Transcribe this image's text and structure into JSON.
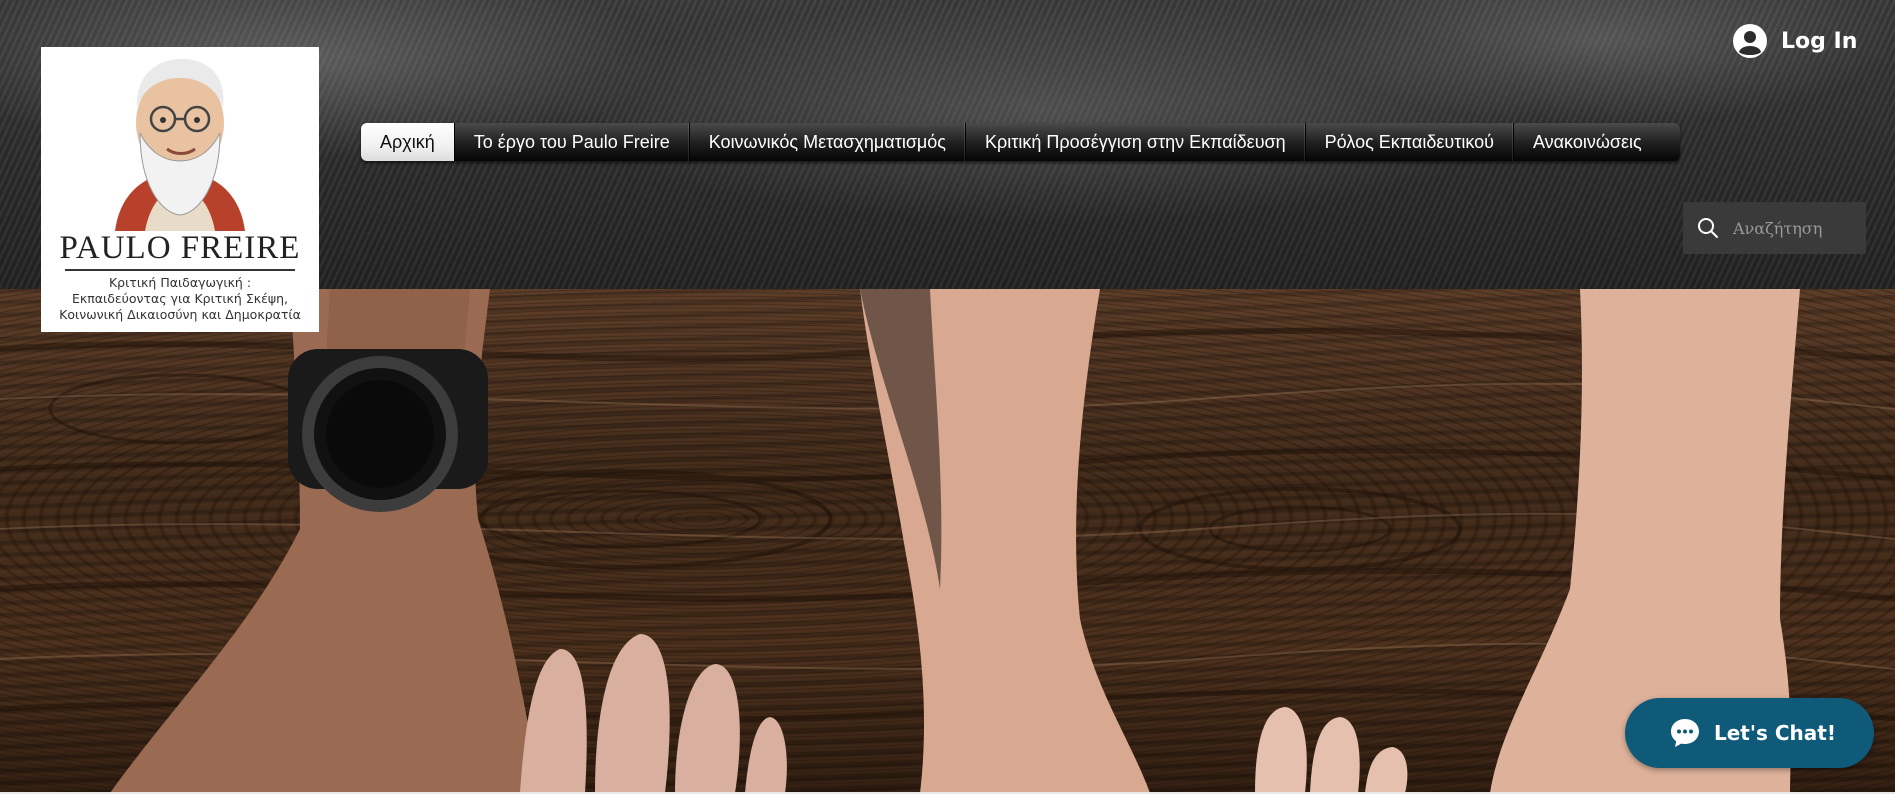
{
  "logo": {
    "title": "PAULO FREIRE",
    "subtitle_lines": [
      "Κριτική Παιδαγωγική :",
      "Εκπαιδεύοντας για Κριτική Σκέψη,",
      "Κοινωνική Δικαιοσύνη και Δημοκρατία"
    ]
  },
  "header": {
    "login_label": "Log In",
    "login_icon": "user-avatar-icon"
  },
  "nav": {
    "items": [
      {
        "label": "Αρχική",
        "active": true
      },
      {
        "label": "Το έργο του Paulo Freire",
        "active": false
      },
      {
        "label": "Κοινωνικός Μετασχηματισμός",
        "active": false
      },
      {
        "label": "Κριτική Προσέγγιση στην Εκπαίδευση",
        "active": false
      },
      {
        "label": "Ρόλος Εκπαιδευτικού",
        "active": false
      },
      {
        "label": "Ανακοινώσεις",
        "active": false
      }
    ]
  },
  "search": {
    "placeholder": "Αναζήτηση",
    "icon": "search-icon"
  },
  "chat": {
    "label": "Let's Chat!",
    "icon": "chat-bubble-icon",
    "color": "#0f5a78"
  },
  "colors": {
    "header_bg": "#2c2c2c",
    "nav_bg": "#1e1e1e",
    "nav_active_bg": "#f1f1f1"
  }
}
